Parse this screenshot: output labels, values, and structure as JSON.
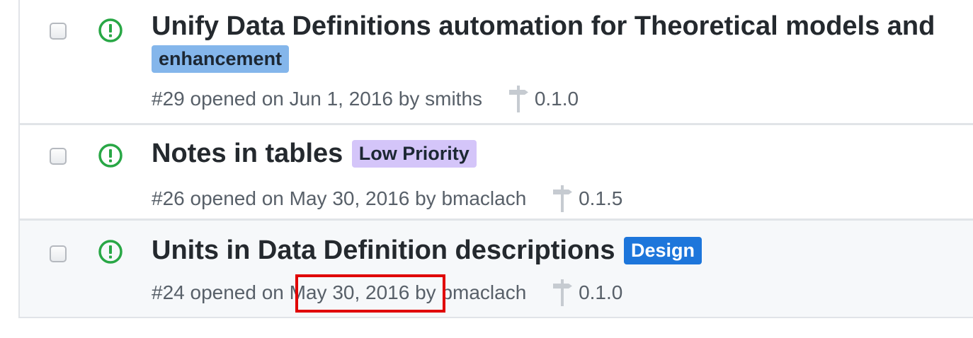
{
  "issues": [
    {
      "title": "Unify Data Definitions automation for Theoretical models and",
      "label": "enhancement",
      "number": "#29",
      "opened_text": "opened on",
      "date": "Jun 1, 2016",
      "by_text": "by",
      "author": "smiths",
      "milestone": "0.1.0"
    },
    {
      "title": "Notes in tables",
      "label": "Low Priority",
      "number": "#26",
      "opened_text": "opened on",
      "date": "May 30, 2016",
      "by_text": "by",
      "author": "bmaclach",
      "milestone": "0.1.5"
    },
    {
      "title": "Units in Data Definition descriptions",
      "label": "Design",
      "number": "#24",
      "opened_text": "opened on",
      "date": "May 30, 2016",
      "by_text": "by",
      "author": "bmaclach",
      "milestone": "0.1.0"
    }
  ],
  "colors": {
    "open_icon": "#28a745",
    "enhancement": "#84b6eb",
    "low_priority": "#d4c5f9",
    "design": "#1d76db",
    "highlight_box": "#e00000"
  },
  "icons": {
    "state": "issue-opened-icon",
    "milestone": "milestone-icon"
  }
}
